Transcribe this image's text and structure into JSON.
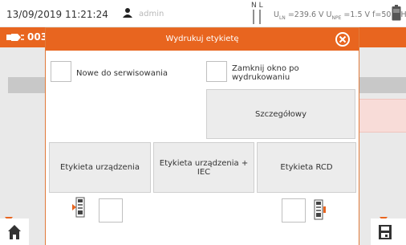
{
  "status_bar": {
    "datetime": "13/09/2019 11:21:24",
    "user": "admin",
    "phase_label": "N L",
    "measurements": {
      "uln_label": "U",
      "uln_sub": "LN",
      "uln_value": " =239.6 V ",
      "unpe_label": "U",
      "unpe_sub": "NPE",
      "unpe_value": " =1.5 V ",
      "freq": "f=50.0 Hz"
    }
  },
  "background": {
    "header_title": "003"
  },
  "dialog": {
    "title": "Wydrukuj etykietę",
    "checkbox_new_label": "Nowe do serwisowania",
    "checkbox_close_label": "Zamknij okno po wydrukowaniu",
    "detailed_label": "Szczegółowy",
    "buttons": {
      "device_label": "Etykieta urządzenia",
      "device_iec_label": "Etykieta urządzenia + IEC",
      "rcd_label": "Etykieta RCD"
    }
  },
  "colors": {
    "accent": "#e8651f",
    "background": "#e9e9e9",
    "button": "#ececec"
  }
}
